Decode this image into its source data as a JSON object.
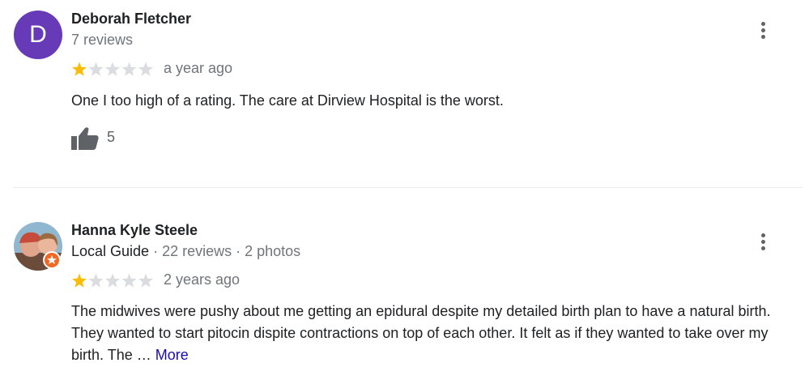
{
  "reviews": [
    {
      "author_name": "Deborah Fletcher",
      "avatar_letter": "D",
      "avatar_color": "#673ab7",
      "reviews_count": "7 reviews",
      "rating": 1,
      "rating_max": 5,
      "date": "a year ago",
      "text": "One I too high of a rating. The care at Dirview Hospital is the worst.",
      "likes": "5",
      "like_icon": "thumbs-up-icon",
      "menu_icon": "more-vert-icon"
    },
    {
      "author_name": "Hanna Kyle Steele",
      "local_guide": "Local Guide",
      "separator": " · ",
      "reviews_count": "22 reviews",
      "photos_count": "2 photos",
      "badge_icon": "local-guide-badge-icon",
      "rating": 1,
      "rating_max": 5,
      "date": "2 years ago",
      "text": "The midwives were pushy about me getting an epidural despite my detailed birth plan to have a natural birth. They wanted to start pitocin dispite contractions on top of each other. It felt as if they wanted to take over my birth. The … ",
      "more_label": "More",
      "menu_icon": "more-vert-icon"
    }
  ],
  "colors": {
    "star_filled": "#fbbc04",
    "star_empty": "#dadce0",
    "link": "#1a0dab",
    "secondary_text": "#70757a",
    "badge_orange": "#f26722"
  }
}
